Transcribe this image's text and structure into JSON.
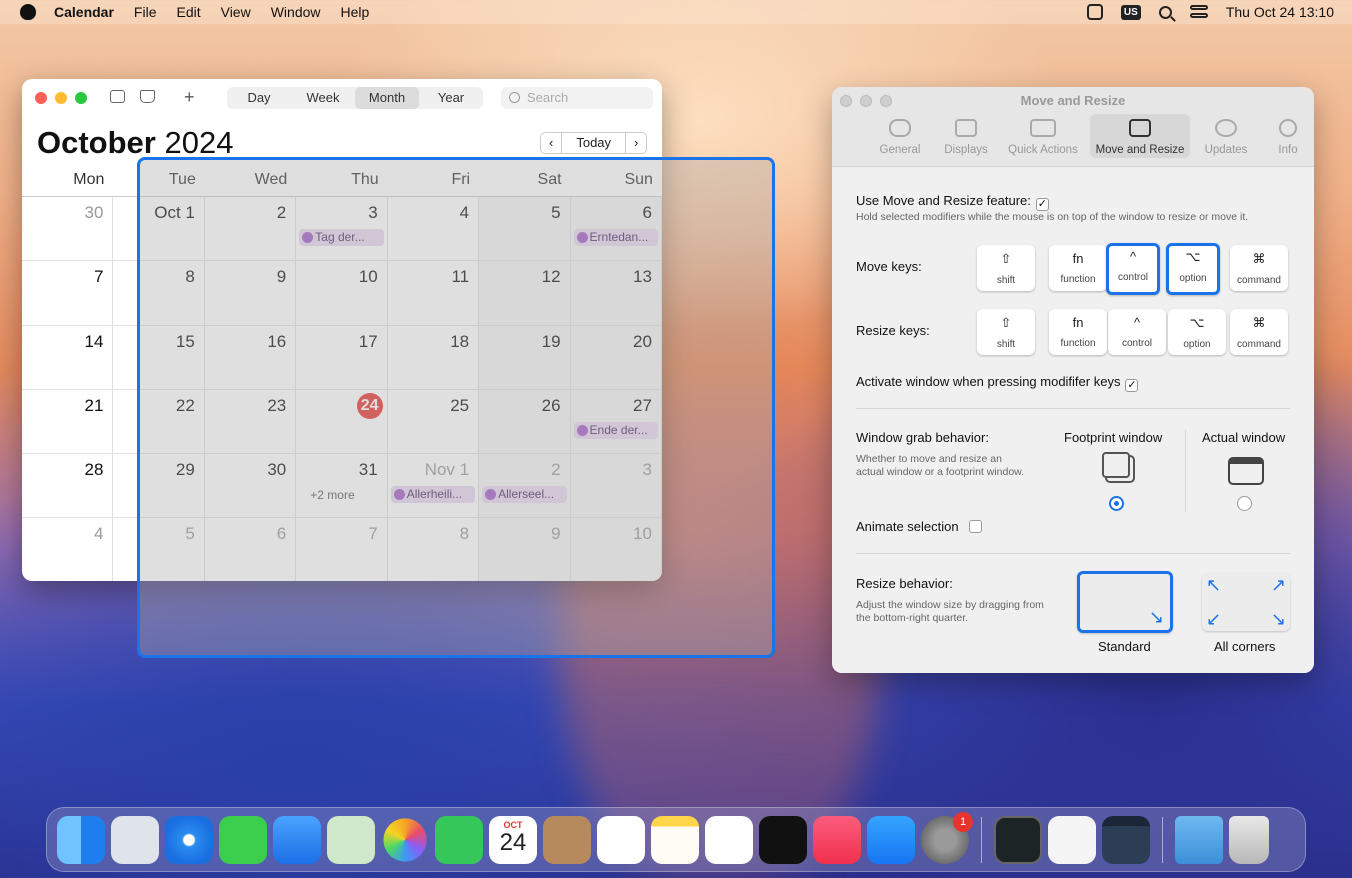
{
  "menubar": {
    "app": "Calendar",
    "items": [
      "File",
      "Edit",
      "View",
      "Window",
      "Help"
    ],
    "input_badge": "US",
    "clock": "Thu Oct 24  13:10"
  },
  "calendar": {
    "views": [
      "Day",
      "Week",
      "Month",
      "Year"
    ],
    "active_view": "Month",
    "search_placeholder": "Search",
    "month": "October",
    "year": "2024",
    "today_button": "Today",
    "weekdays": [
      "Mon",
      "Tue",
      "Wed",
      "Thu",
      "Fri",
      "Sat",
      "Sun"
    ],
    "weeks": [
      [
        {
          "d": "30",
          "dim": true
        },
        {
          "d": "Oct 1"
        },
        {
          "d": "2"
        },
        {
          "d": "3",
          "event": "Tag der..."
        },
        {
          "d": "4"
        },
        {
          "d": "5"
        },
        {
          "d": "6",
          "event": "Erntedan..."
        }
      ],
      [
        {
          "d": "7"
        },
        {
          "d": "8"
        },
        {
          "d": "9"
        },
        {
          "d": "10"
        },
        {
          "d": "11"
        },
        {
          "d": "12"
        },
        {
          "d": "13"
        }
      ],
      [
        {
          "d": "14"
        },
        {
          "d": "15"
        },
        {
          "d": "16"
        },
        {
          "d": "17"
        },
        {
          "d": "18"
        },
        {
          "d": "19"
        },
        {
          "d": "20"
        }
      ],
      [
        {
          "d": "21"
        },
        {
          "d": "22"
        },
        {
          "d": "23"
        },
        {
          "d": "24",
          "today": true
        },
        {
          "d": "25"
        },
        {
          "d": "26"
        },
        {
          "d": "27",
          "event": "Ende der..."
        }
      ],
      [
        {
          "d": "28"
        },
        {
          "d": "29"
        },
        {
          "d": "30"
        },
        {
          "d": "31",
          "more": "+2 more"
        },
        {
          "d": "Nov 1",
          "dim": true,
          "event": "Allerheili..."
        },
        {
          "d": "2",
          "dim": true,
          "event": "Allerseel..."
        },
        {
          "d": "3",
          "dim": true
        }
      ],
      [
        {
          "d": "4",
          "dim": true
        },
        {
          "d": "5",
          "dim": true
        },
        {
          "d": "6",
          "dim": true
        },
        {
          "d": "7",
          "dim": true
        },
        {
          "d": "8",
          "dim": true
        },
        {
          "d": "9",
          "dim": true
        },
        {
          "d": "10",
          "dim": true
        }
      ]
    ]
  },
  "prefs": {
    "title": "Move and Resize",
    "tabs": [
      "General",
      "Displays",
      "Quick Actions",
      "Move and Resize",
      "Updates",
      "Info"
    ],
    "active_tab": "Move and Resize",
    "use_feature_label": "Use Move and Resize feature:",
    "use_feature_checked": true,
    "use_feature_help": "Hold selected modifiers while the mouse is on top of the window to resize or move it.",
    "move_keys_label": "Move keys:",
    "resize_keys_label": "Resize keys:",
    "keys": [
      {
        "sym": "⇧",
        "name": "shift"
      },
      {
        "sym": "fn",
        "name": "function"
      },
      {
        "sym": "^",
        "name": "control"
      },
      {
        "sym": "⌥",
        "name": "option"
      },
      {
        "sym": "⌘",
        "name": "command"
      }
    ],
    "move_selected": [
      "control",
      "option"
    ],
    "resize_selected": "Standard",
    "activate_label": "Activate window when pressing modififer keys",
    "activate_checked": true,
    "grab_label": "Window grab behavior:",
    "grab_help": "Whether to move and resize an actual window or a footprint window.",
    "grab_options": [
      "Footprint window",
      "Actual window"
    ],
    "grab_selected": "Footprint window",
    "animate_label": "Animate selection",
    "animate_checked": false,
    "resize_label": "Resize behavior:",
    "resize_help": "Adjust the window size by dragging from the bottom-right quarter.",
    "resize_options": [
      "Standard",
      "All corners"
    ]
  },
  "dock": {
    "calendar_month": "OCT",
    "calendar_day": "24",
    "settings_badge": "1"
  }
}
